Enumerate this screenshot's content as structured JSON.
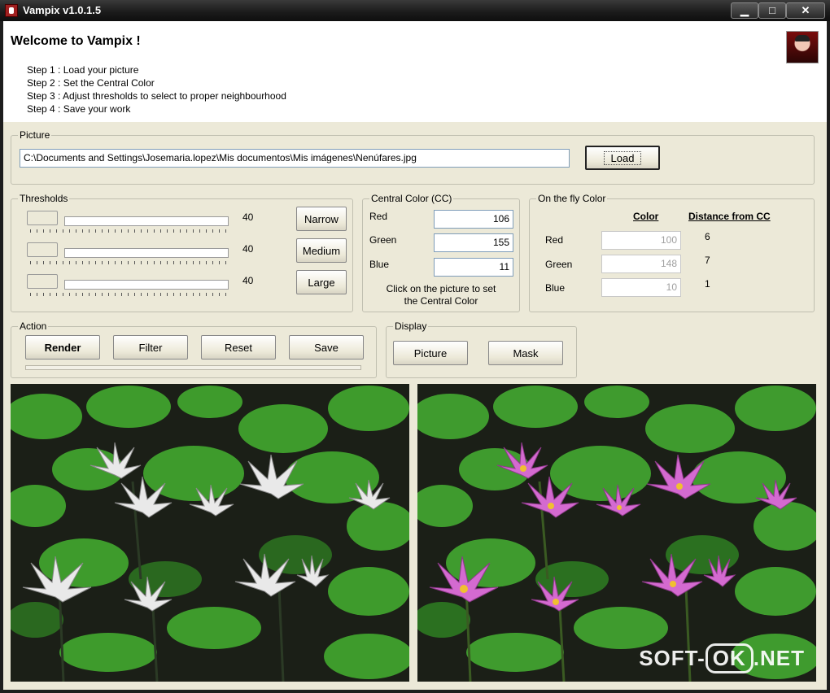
{
  "window": {
    "title": "Vampix v1.0.1.5",
    "min": "▁",
    "max": "□",
    "close": "✕"
  },
  "welcome": {
    "heading": "Welcome to Vampix !",
    "steps": [
      "Step 1 : Load your picture",
      "Step 2 : Set the Central Color",
      "Step 3 : Adjust thresholds to select to proper neighbourhood",
      "Step 4 : Save your work"
    ]
  },
  "picture": {
    "legend": "Picture",
    "path": "C:\\Documents and Settings\\Josemaria.lopez\\Mis documentos\\Mis imágenes\\Nenúfares.jpg",
    "load_label": "Load"
  },
  "thresholds": {
    "legend": "Thresholds",
    "values": [
      "40",
      "40",
      "40"
    ],
    "narrow_label": "Narrow",
    "medium_label": "Medium",
    "large_label": "Large"
  },
  "central_color": {
    "legend": "Central Color (CC)",
    "red_label": "Red",
    "red": "106",
    "green_label": "Green",
    "green": "155",
    "blue_label": "Blue",
    "blue": "11",
    "hint_line1": "Click on the picture to set",
    "hint_line2": "the Central Color"
  },
  "fly_color": {
    "legend": "On the fly Color",
    "color_header": "Color",
    "distance_header": "Distance from CC",
    "red_label": "Red",
    "red": "100",
    "red_dist": "6",
    "green_label": "Green",
    "green": "148",
    "green_dist": "7",
    "blue_label": "Blue",
    "blue": "10",
    "blue_dist": "1"
  },
  "action": {
    "legend": "Action",
    "render_label": "Render",
    "filter_label": "Filter",
    "reset_label": "Reset",
    "save_label": "Save"
  },
  "display": {
    "legend": "Display",
    "picture_label": "Picture",
    "mask_label": "Mask"
  },
  "watermark": {
    "left": "SOFT-",
    "middle": "OK",
    "right": ".NET"
  },
  "colors": {
    "titlebar": "#1c1c1c",
    "dialog": "#ece9d8",
    "lily_pink": "#d46ad0",
    "leaf_green": "#3f9b2e"
  }
}
